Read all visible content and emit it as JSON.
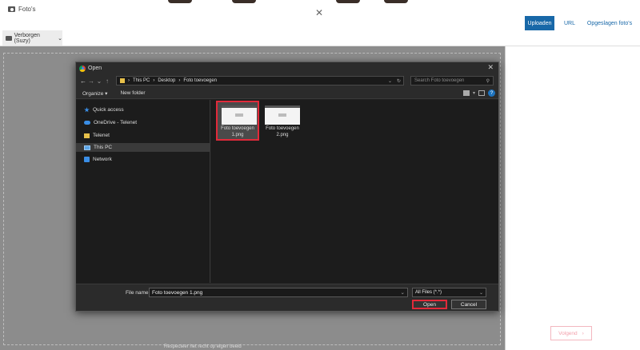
{
  "page": {
    "title": "Foto's",
    "tabs": {
      "upload": "Uploaden",
      "url": "URL",
      "saved": "Opgeslagen foto's"
    },
    "album": "Verborgen (Suzy)",
    "next_button": "Volgend",
    "bottom_hint": "Respecteer het recht op eigen beeld"
  },
  "dialog": {
    "title": "Open",
    "close": "✕",
    "breadcrumb": [
      "This PC",
      "Desktop",
      "Foto toevoegen"
    ],
    "search_placeholder": "Search Foto toevoegen",
    "toolbar": {
      "organize": "Organize ▾",
      "new_folder": "New folder"
    },
    "sidebar": [
      {
        "label": "Quick access"
      },
      {
        "label": "OneDrive - Telenet"
      },
      {
        "label": "Telenet"
      },
      {
        "label": "This PC"
      },
      {
        "label": "Network"
      }
    ],
    "files": [
      {
        "line1": "Foto toevoegen",
        "line2": "1.png"
      },
      {
        "line1": "Foto toevoegen",
        "line2": "2.png"
      }
    ],
    "footer": {
      "file_name_label": "File name:",
      "file_name_value": "Foto toevoegen 1.png",
      "file_type": "All Files (*.*)",
      "open": "Open",
      "cancel": "Cancel"
    }
  },
  "colors": {
    "accent": "#1868a8",
    "selection_outline": "#e12a3a",
    "dialog_bg": "#202020"
  }
}
